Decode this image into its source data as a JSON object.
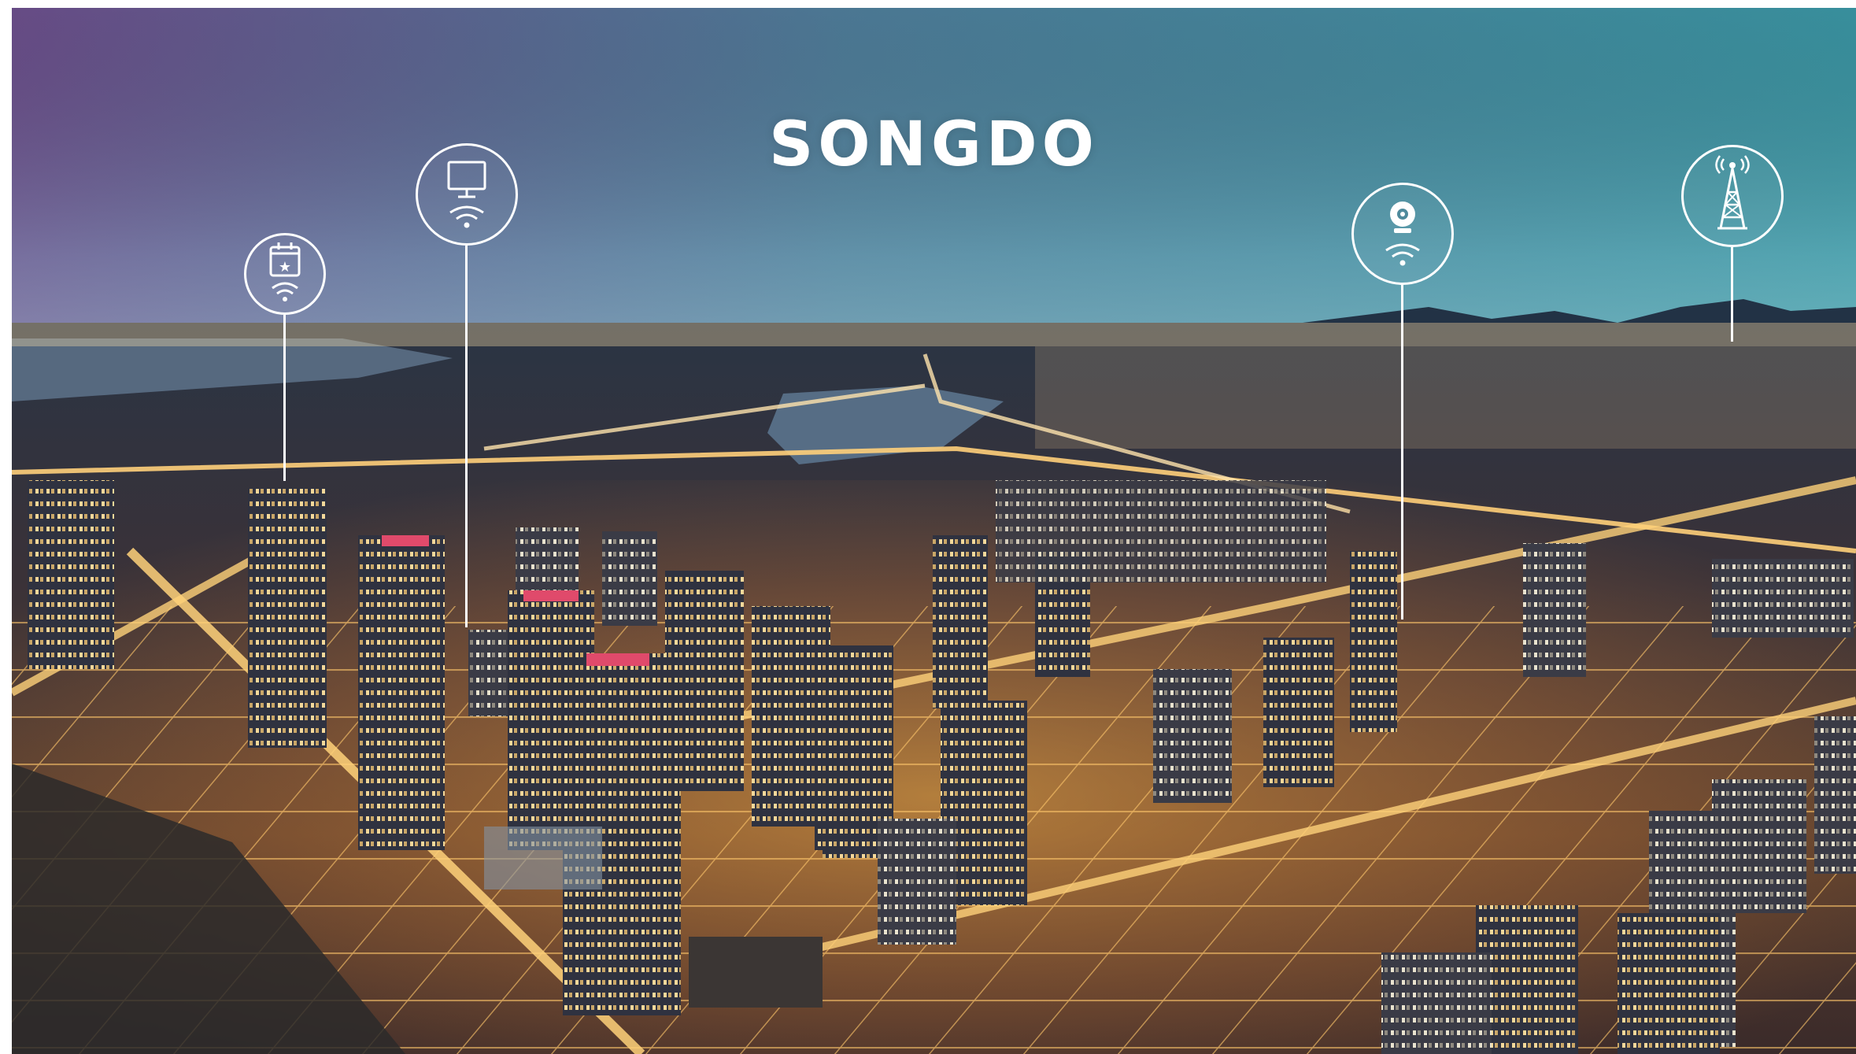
{
  "scene": {
    "title": "SONGDO",
    "colors": {
      "sky_top_left": "#6b4f8a",
      "sky_top_right": "#3f8fa0",
      "horizon_glow": "#7fb6c0",
      "city_light": "#ffb347",
      "title_color": "#ffffff"
    },
    "markers": [
      {
        "icon": "calendar-star-wifi-icon"
      },
      {
        "icon": "monitor-wifi-icon"
      },
      {
        "icon": "webcam-wifi-icon"
      },
      {
        "icon": "radio-tower-icon"
      }
    ]
  }
}
